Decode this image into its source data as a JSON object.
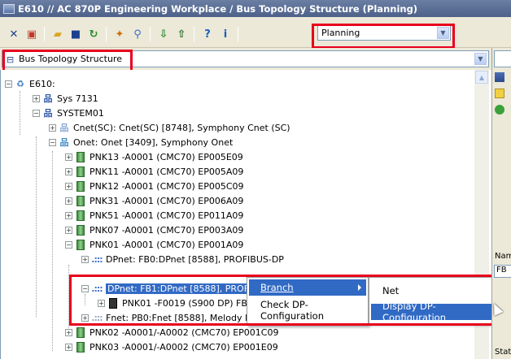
{
  "window": {
    "title": "E610 // AC 870P Engineering Workplace / Bus Topology Structure (Planning)"
  },
  "toolbar": {
    "mode_select": {
      "value": "Planning"
    }
  },
  "structure_select": {
    "value": "Bus Topology Structure"
  },
  "tree": {
    "nodes": [
      {
        "label": "E610:"
      },
      {
        "label": "Sys 7131"
      },
      {
        "label": "SYSTEM01"
      },
      {
        "label": "Cnet(SC): Cnet(SC) [8748], Symphony Cnet (SC)"
      },
      {
        "label": "Onet: Onet [3409], Symphony Onet"
      },
      {
        "label": "PNK13 -A0001 (CMC70) EP005E09"
      },
      {
        "label": "PNK11 -A0001 (CMC70) EP005A09"
      },
      {
        "label": "PNK12 -A0001 (CMC70) EP005C09"
      },
      {
        "label": "PNK31 -A0001 (CMC70) EP006A09"
      },
      {
        "label": "PNK51 -A0001 (CMC70) EP011A09"
      },
      {
        "label": "PNK07 -A0001 (CMC70) EP003A09"
      },
      {
        "label": "PNK01 -A0001 (CMC70) EP001A09"
      },
      {
        "label": "DPnet: FB0:DPnet [8588], PROFIBUS-DP"
      },
      {
        "label": "DPnet: FB1:DPnet [8588], PROFI"
      },
      {
        "label": "PNK01 -F0019 (S900 DP) FB1"
      },
      {
        "label": "Fnet: PB0:Fnet [8588], Melody Fner"
      },
      {
        "label": "PNK02 -A0001/-A0002 (CMC70) EP001C09"
      },
      {
        "label": "PNK03 -A0001/-A0002 (CMC70) EP001E09"
      }
    ]
  },
  "context_menu": {
    "items": [
      {
        "label": "Branch"
      },
      {
        "label": "Check DP-Configuration"
      }
    ]
  },
  "submenu": {
    "items": [
      {
        "label": "Net"
      },
      {
        "label": "Display DP-Configuration"
      }
    ]
  },
  "right_panel": {
    "labels": [
      "Nam",
      "FB",
      "Stat"
    ]
  }
}
